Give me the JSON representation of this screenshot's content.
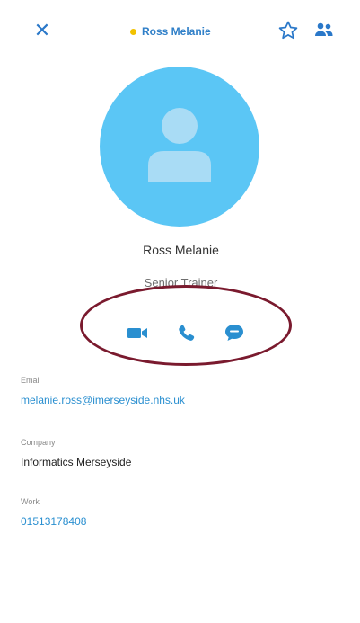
{
  "header": {
    "title": "Ross Melanie",
    "close_icon": "close-icon",
    "favorite_icon": "star-outline-icon",
    "people_icon": "people-icon",
    "presence_color": "#f2c200",
    "accent_color": "#2a78c9"
  },
  "profile": {
    "avatar_icon": "person-placeholder-icon",
    "avatar_color": "#5bc6f5",
    "name": "Ross Melanie",
    "role": "Senior Trainer"
  },
  "actions": [
    {
      "name": "video-call",
      "icon": "video-camera-icon"
    },
    {
      "name": "voice-call",
      "icon": "phone-icon"
    },
    {
      "name": "chat",
      "icon": "chat-bubble-icon"
    }
  ],
  "details": {
    "email": {
      "label": "Email",
      "value": "melanie.ross@imerseyside.nhs.uk"
    },
    "company": {
      "label": "Company",
      "value": "Informatics Merseyside"
    },
    "work": {
      "label": "Work",
      "value": "01513178408"
    }
  },
  "annotation": {
    "ellipse_color": "#7a1a2e"
  }
}
